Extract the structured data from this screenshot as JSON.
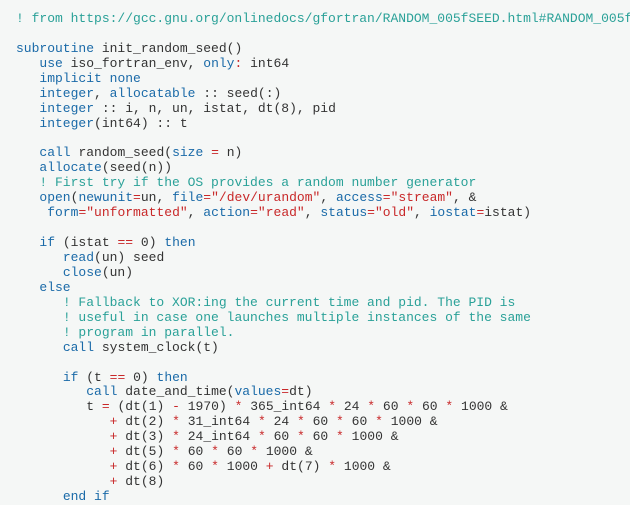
{
  "code": {
    "l1": "! from https://gcc.gnu.org/onlinedocs/gfortran/RANDOM_005fSEED.html#RANDOM_005f",
    "l3_a": "subroutine",
    "l3_b": "init_random_seed()",
    "l4_a": "use",
    "l4_b": "iso_fortran_env,",
    "l4_c": "only",
    "l4_d": ":",
    "l4_e": "int64",
    "l5_a": "implicit",
    "l5_b": "none",
    "l6_a": "integer",
    "l6_b": ",",
    "l6_c": "allocatable",
    "l6_d": ":: seed(:)",
    "l7_a": "integer",
    "l7_b": ":: i, n, un, istat, dt(",
    "l7_c": "8",
    "l7_d": "), pid",
    "l8_a": "integer",
    "l8_b": "(int64) :: t",
    "l10_a": "call",
    "l10_b": "random_seed(",
    "l10_c": "size",
    "l10_d": "=",
    "l10_e": "n)",
    "l11_a": "allocate",
    "l11_b": "(seed(n))",
    "l12": "! First try if the OS provides a random number generator",
    "l13_a": "open",
    "l13_b": "(",
    "l13_c": "newunit",
    "l13_d": "=",
    "l13_e": "un,",
    "l13_f": "file",
    "l13_g": "=",
    "l13_h": "\"/dev/urandom\"",
    "l13_i": ",",
    "l13_j": "access",
    "l13_k": "=",
    "l13_l": "\"stream\"",
    "l13_m": ", &",
    "l14_a": "form",
    "l14_b": "=",
    "l14_c": "\"unformatted\"",
    "l14_d": ",",
    "l14_e": "action",
    "l14_f": "=",
    "l14_g": "\"read\"",
    "l14_h": ",",
    "l14_i": "status",
    "l14_j": "=",
    "l14_k": "\"old\"",
    "l14_l": ",",
    "l14_m": "iostat",
    "l14_n": "=",
    "l14_o": "istat)",
    "l16_a": "if",
    "l16_b": "(istat",
    "l16_c": "==",
    "l16_d": "0",
    "l16_e": ")",
    "l16_f": "then",
    "l17_a": "read",
    "l17_b": "(un) seed",
    "l18_a": "close",
    "l18_b": "(un)",
    "l19": "else",
    "l20": "! Fallback to XOR:ing the current time and pid. The PID is",
    "l21": "! useful in case one launches multiple instances of the same",
    "l22": "! program in parallel.",
    "l23_a": "call",
    "l23_b": "system_clock(t)",
    "l25_a": "if",
    "l25_b": "(t",
    "l25_c": "==",
    "l25_d": "0",
    "l25_e": ")",
    "l25_f": "then",
    "l26_a": "call",
    "l26_b": "date_and_time(",
    "l26_c": "values",
    "l26_d": "=",
    "l26_e": "dt)",
    "l27_a": "t",
    "l27_b": "=",
    "l27_c": "(dt(",
    "l27_d": "1",
    "l27_e": ")",
    "l27_f": "-",
    "l27_g": "1970",
    "l27_h": ")",
    "l27_i": "*",
    "l27_j": "365",
    "l27_k": "_int64",
    "l27_l": "*",
    "l27_m": "24",
    "l27_n": "*",
    "l27_o": "60",
    "l27_p": "*",
    "l27_q": "60",
    "l27_r": "*",
    "l27_s": "1000",
    "l27_t": "&",
    "l28_a": "+",
    "l28_b": "dt(",
    "l28_c": "2",
    "l28_d": ")",
    "l28_e": "*",
    "l28_f": "31",
    "l28_g": "_int64",
    "l28_h": "*",
    "l28_i": "24",
    "l28_j": "*",
    "l28_k": "60",
    "l28_l": "*",
    "l28_m": "60",
    "l28_n": "*",
    "l28_o": "1000",
    "l28_p": "&",
    "l29_a": "+",
    "l29_b": "dt(",
    "l29_c": "3",
    "l29_d": ")",
    "l29_e": "*",
    "l29_f": "24",
    "l29_g": "_int64",
    "l29_h": "*",
    "l29_i": "60",
    "l29_j": "*",
    "l29_k": "60",
    "l29_l": "*",
    "l29_m": "1000",
    "l29_n": "&",
    "l30_a": "+",
    "l30_b": "dt(",
    "l30_c": "5",
    "l30_d": ")",
    "l30_e": "*",
    "l30_f": "60",
    "l30_g": "*",
    "l30_h": "60",
    "l30_i": "*",
    "l30_j": "1000",
    "l30_k": "&",
    "l31_a": "+",
    "l31_b": "dt(",
    "l31_c": "6",
    "l31_d": ")",
    "l31_e": "*",
    "l31_f": "60",
    "l31_g": "*",
    "l31_h": "1000",
    "l31_i": "+",
    "l31_j": "dt(",
    "l31_k": "7",
    "l31_l": ")",
    "l31_m": "*",
    "l31_n": "1000",
    "l31_o": "&",
    "l32_a": "+",
    "l32_b": "dt(",
    "l32_c": "8",
    "l32_d": ")",
    "l33_a": "end",
    "l33_b": "if"
  }
}
